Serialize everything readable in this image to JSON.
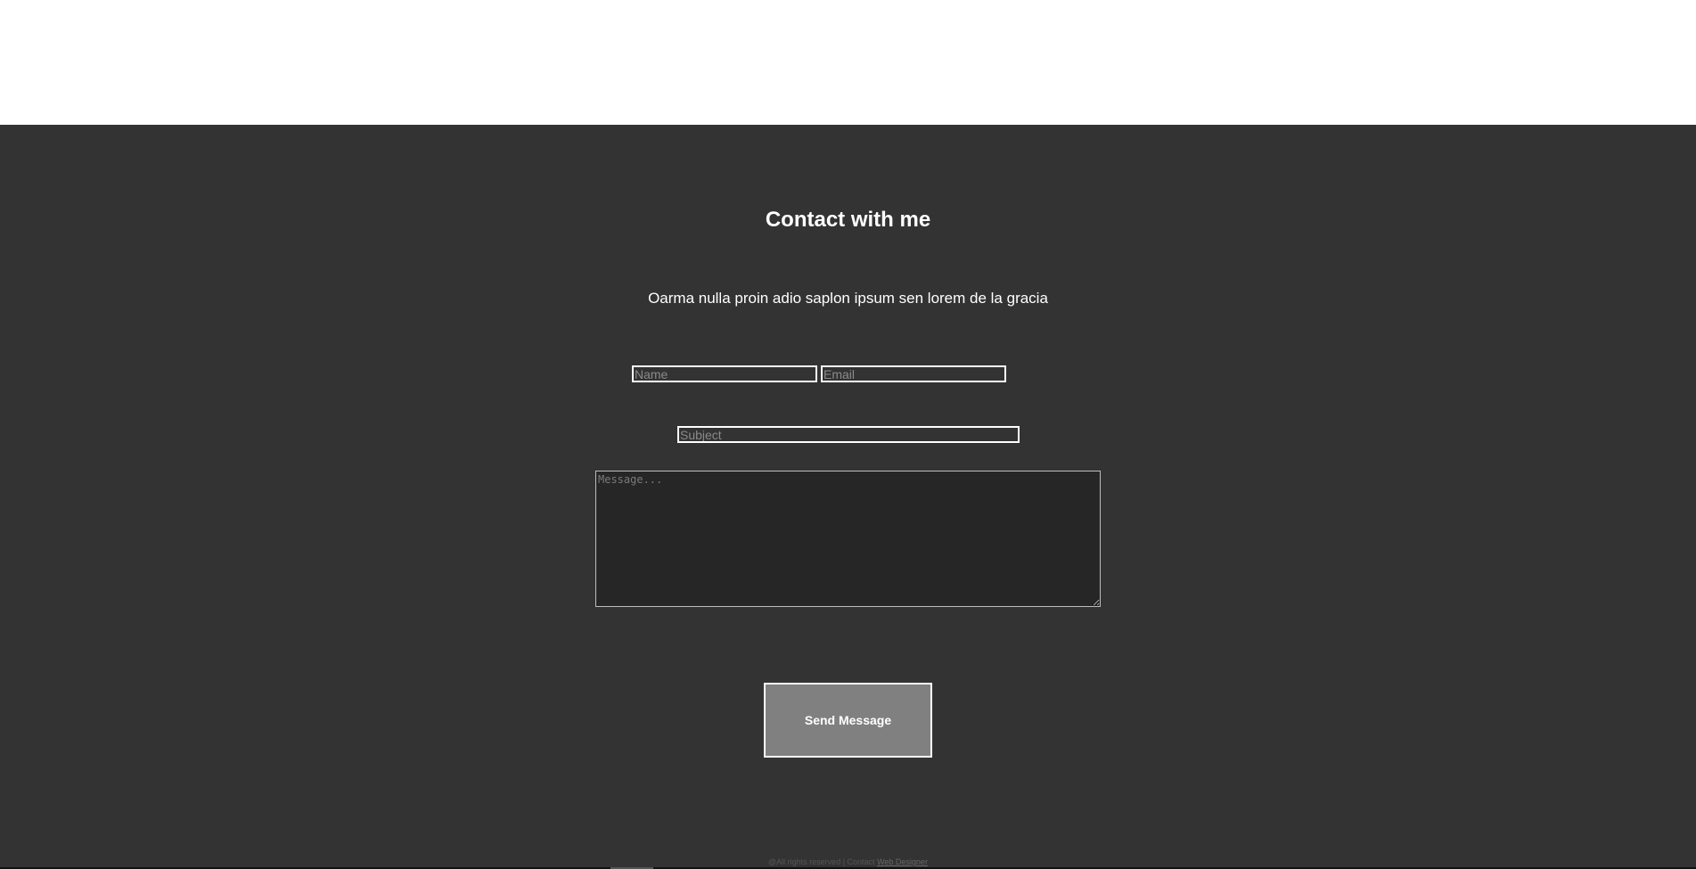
{
  "contact": {
    "title": "Contact with me",
    "subtitle": "Oarma nulla proin adio saplon ipsum sen lorem de la gracia",
    "form": {
      "name_placeholder": "Name",
      "email_placeholder": "Email",
      "subject_placeholder": "Subject",
      "message_placeholder": "Message...",
      "send_label": "Send Message"
    }
  },
  "footer": {
    "text": "@All rights reserved | Contact",
    "link_text": "Web Designer"
  },
  "colors": {
    "page_background": "#ffffff",
    "section_background": "#333333",
    "message_background": "#262626",
    "button_background": "#808080",
    "text": "#ffffff"
  }
}
